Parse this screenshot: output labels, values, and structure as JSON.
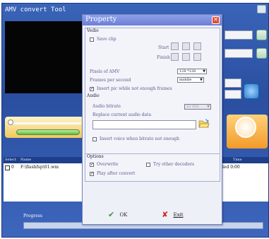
{
  "main_window": {
    "title": "AMV convert Tool",
    "list_columns": [
      "Select",
      "Name",
      "Time"
    ],
    "list_rows": [
      {
        "index": "0",
        "name": "F:\\flashfsp\\01.wm",
        "status": "led 0:00"
      }
    ],
    "progress_label": "Progress",
    "progress_value": 0
  },
  "dialog": {
    "title": "Property",
    "video": {
      "group_label": "Vedio",
      "save_clip_label": "Save clip",
      "start_label": "Start",
      "finish_label": "Finish",
      "pixels_label": "Pixels of AMV",
      "pixels_value": "128 *128",
      "fps_label": "Frames per second",
      "fps_value": "middle",
      "insert_pic_label": "Insert pic while not enough frames"
    },
    "audio": {
      "group_label": "Audio",
      "bitrate_label": "Audio bitrate",
      "bitrate_value": "22 050",
      "replace_label": "Replace current audio data",
      "replace_value": "",
      "insert_voice_label": "Insert voice when bitrate not enough"
    },
    "options": {
      "group_label": "Options",
      "overwrite_label": "Overwrite",
      "try_decoders_label": "Try other decoders",
      "play_after_label": "Play after convert"
    },
    "ok_label": "OK",
    "exit_label": "Exit"
  },
  "checkbox_state": {
    "save_clip": false,
    "insert_pic": true,
    "insert_voice": false,
    "overwrite": true,
    "try_decoders": false,
    "play_after": true
  },
  "icons": [
    "close-icon",
    "folder-open-icon",
    "ok-checkmark-icon",
    "exit-x-icon",
    "refresh-icon",
    "play-icon"
  ],
  "colors": {
    "main_background": "#2a4fa0",
    "dialog_title_bar": "#7a8be0",
    "dialog_close": "#e54a2a",
    "ok_icon": "#2fa02f",
    "exit_icon": "#d62020"
  }
}
